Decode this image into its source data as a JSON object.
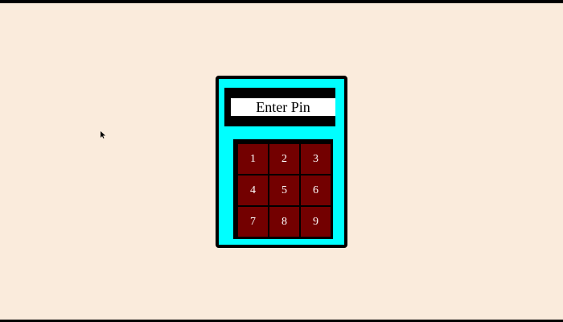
{
  "colors": {
    "background": "#faebdc",
    "device_body": "#00ffff",
    "device_border": "#000000",
    "display_bg": "#000000",
    "display_field": "#ffffff",
    "key_bg": "#730000",
    "key_text": "#ffffff"
  },
  "display": {
    "text": "Enter Pin"
  },
  "keypad": {
    "keys": [
      "1",
      "2",
      "3",
      "4",
      "5",
      "6",
      "7",
      "8",
      "9"
    ]
  },
  "cursor": {
    "icon": "mouse-pointer-icon"
  }
}
